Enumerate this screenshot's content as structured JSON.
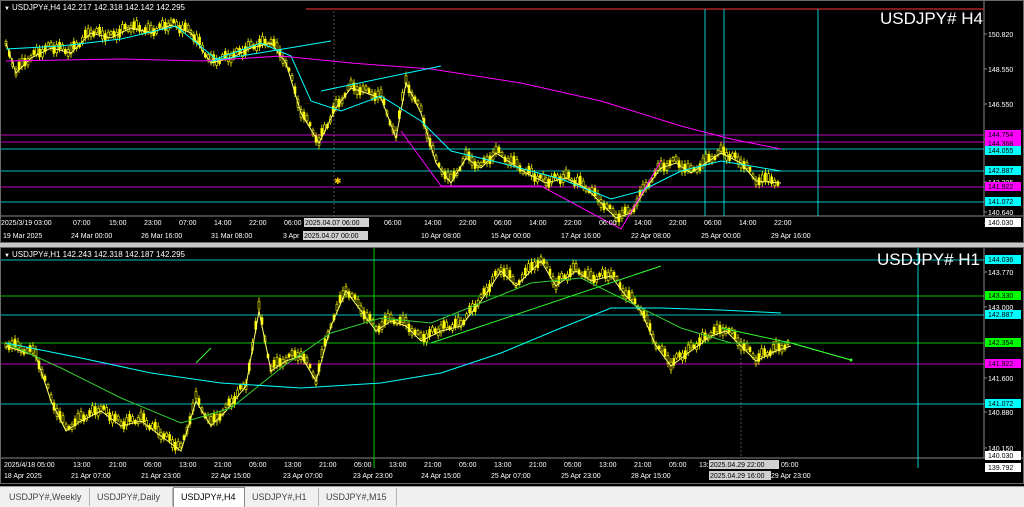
{
  "h4": {
    "header": "USDJPY#,H4  142.217 142.318 142.142 142.295",
    "title": "USDJPY# H4",
    "price_ticks": [
      "150.820",
      "148.550",
      "146.550",
      "144.555",
      "142.295",
      "140.640",
      "140.030"
    ],
    "price_boxes": [
      {
        "label": "144.754",
        "bg": "#ff00ff",
        "fg": "#000"
      },
      {
        "label": "144.368",
        "bg": "#ff00ff",
        "fg": "#000"
      },
      {
        "label": "144.055",
        "bg": "#00ffff",
        "fg": "#000"
      },
      {
        "label": "142.887",
        "bg": "#00ffff",
        "fg": "#000"
      },
      {
        "label": "141.922",
        "bg": "#ff00ff",
        "fg": "#000"
      },
      {
        "label": "141.072",
        "bg": "#00ffff",
        "fg": "#000"
      },
      {
        "label": "140.030",
        "bg": "#ffffff",
        "fg": "#000"
      }
    ],
    "time_row1": [
      "2025/3/19 03:00",
      "07:00",
      "15:00",
      "23:00",
      "07:00",
      "14:00",
      "22:00",
      "06:00",
      "2025.04.07 06:00",
      "06:00",
      "14:00",
      "22:00",
      "06:00",
      "14:00",
      "22:00",
      "06:00",
      "14:00",
      "22:00",
      "06:00",
      "14:00",
      "22:00"
    ],
    "time_row2": [
      "19 Mar 2025",
      "24 Mar 00:00",
      "26 Mar 16:00",
      "31 Mar 08:00",
      "3 Apr",
      "2025.04.07 00:00",
      "10 Apr 08:00",
      "15 Apr 00:00",
      "17 Apr 16:00",
      "22 Apr 08:00",
      "25 Apr 00:00",
      "29 Apr 16:00"
    ]
  },
  "h1": {
    "header": "USDJPY#,H1  142.243 142.318 142.187 142.295",
    "title": "USDJPY# H1",
    "price_ticks": [
      "143.770",
      "143.000",
      "141.600",
      "140.880",
      "140.150"
    ],
    "price_boxes": [
      {
        "label": "144.036",
        "bg": "#00ffff",
        "fg": "#000"
      },
      {
        "label": "143.330",
        "bg": "#00ff00",
        "fg": "#000"
      },
      {
        "label": "142.887",
        "bg": "#00ffff",
        "fg": "#000"
      },
      {
        "label": "142.354",
        "bg": "#00ff00",
        "fg": "#000"
      },
      {
        "label": "141.922",
        "bg": "#ff00ff",
        "fg": "#000"
      },
      {
        "label": "141.072",
        "bg": "#00ffff",
        "fg": "#000"
      },
      {
        "label": "140.030",
        "bg": "#ffffff",
        "fg": "#000"
      },
      {
        "label": "139.792",
        "bg": "#ffffff",
        "fg": "#000"
      }
    ],
    "time_row1": [
      "2025/4/18 05:00",
      "13:00",
      "21:00",
      "05:00",
      "13:00",
      "21:00",
      "05:00",
      "13:00",
      "21:00",
      "05:00",
      "13:00",
      "21:00",
      "05:00",
      "13:00",
      "21:00",
      "05:00",
      "13:00",
      "21:00",
      "05:00",
      "13:00",
      "21:00",
      "05:00",
      "13:00",
      "2025.04.29 22:00",
      "05:00"
    ],
    "time_row2": [
      "18 Apr 2025",
      "21 Apr 07:00",
      "21 Apr 23:00",
      "22 Apr 15:00",
      "23 Apr 07:00",
      "23 Apr 23:00",
      "24 Apr 15:00",
      "25 Apr 07:00",
      "25 Apr 23:00",
      "28 Apr 15:00",
      "2025.04.29 16:00",
      "29 Apr 23:00"
    ]
  },
  "tabs": [
    {
      "label": "USDJPY#,Weekly",
      "active": false
    },
    {
      "label": "USDJPY#,Daily",
      "active": false
    },
    {
      "label": "USDJPY#,H4",
      "active": true
    },
    {
      "label": "USDJPY#,H1",
      "active": false
    },
    {
      "label": "USDJPY#,M15",
      "active": false
    }
  ],
  "colors": {
    "bg": "#000000",
    "candle": "#ffff00",
    "ma_fast": "#ffff66",
    "ma_cyan": "#00ffff",
    "ma_magenta": "#ff00ff",
    "ma_green": "#33cc33",
    "level_green": "#00ff00",
    "vline": "#00ffff"
  }
}
